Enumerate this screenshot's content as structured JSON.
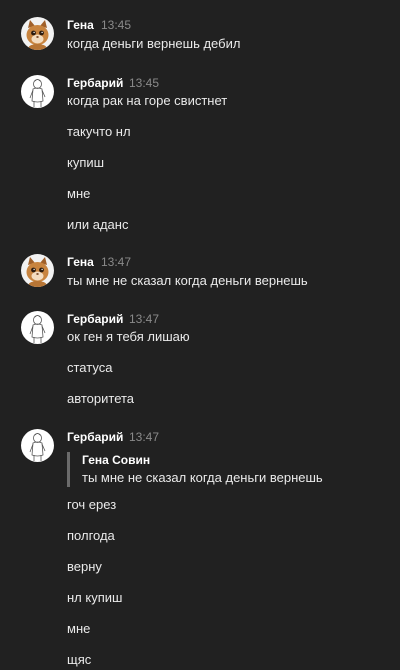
{
  "icons": {
    "gena_avatar": "cat-avatar-icon",
    "gerbariy_avatar": "sketch-figure-avatar-icon"
  },
  "colors": {
    "background": "#212121",
    "author": "#ffffff",
    "timestamp": "#8a8a8a",
    "quote_bar": "#6b6b6b"
  },
  "groups": [
    {
      "author": "Гена",
      "time": "13:45",
      "messages": [
        "когда деньги вернешь дебил"
      ]
    },
    {
      "author": "Гербарий",
      "time": "13:45",
      "messages": [
        "когда рак на горе свистнет",
        "такучто нл",
        "купиш",
        "мне",
        "или аданс"
      ]
    },
    {
      "author": "Гена",
      "time": "13:47",
      "messages": [
        "ты мне не сказал когда деньги вернешь"
      ]
    },
    {
      "author": "Гербарий",
      "time": "13:47",
      "messages": [
        "ок ген я тебя лишаю",
        "статуса",
        "авторитета"
      ]
    },
    {
      "author": "Гербарий",
      "time": "13:47",
      "quote": {
        "author": "Гена Совин",
        "text": "ты мне не сказал когда деньги вернешь"
      },
      "messages": [
        "гоч ерез",
        "полгода",
        "верну",
        "нл купиш",
        "мне",
        "щяс"
      ]
    }
  ]
}
